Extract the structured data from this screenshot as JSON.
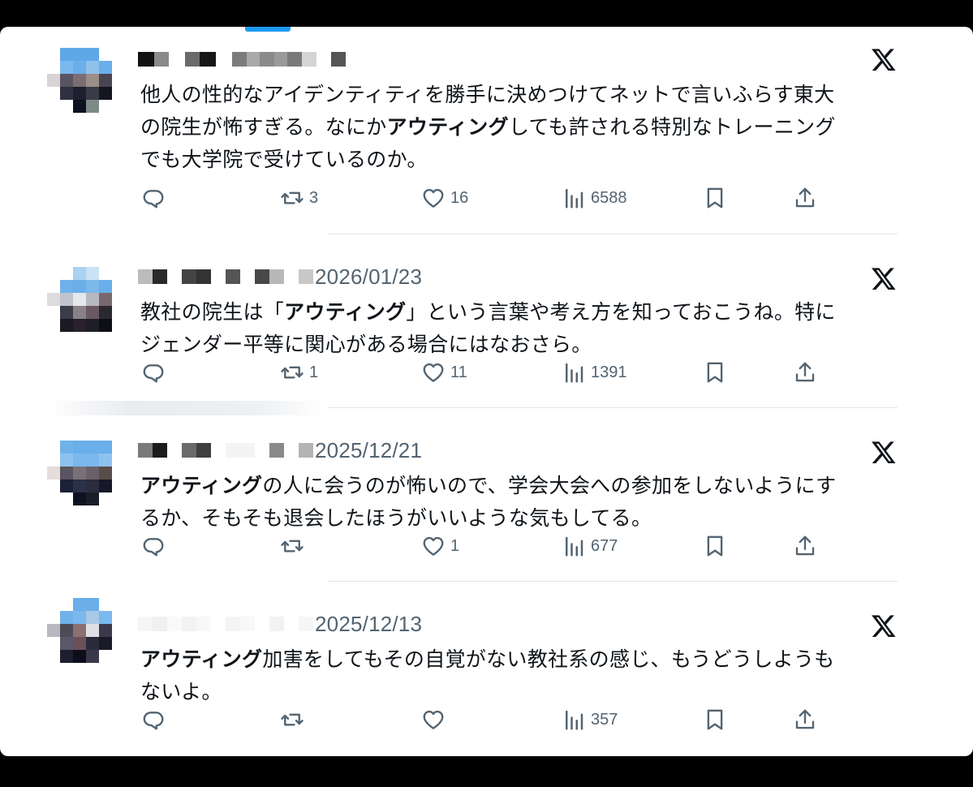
{
  "colors": {
    "accent": "#1d9bf0",
    "text": "#0f1419",
    "muted": "#536471"
  },
  "tweets": [
    {
      "date": "",
      "segments": [
        {
          "t": "他人の性的なアイデンティティを勝手に決めつけてネットで言いふらす東大\nの院生が怖すぎる。なにか",
          "b": false
        },
        {
          "t": "アウティング",
          "b": true
        },
        {
          "t": "しても許される特別なトレーニング\nでも大学院で受けているのか。",
          "b": false
        }
      ],
      "stats": {
        "replies": "",
        "retweets": "3",
        "likes": "16",
        "views": "6588"
      }
    },
    {
      "date": "2026/01/23",
      "segments": [
        {
          "t": "教社の院生は「",
          "b": false
        },
        {
          "t": "アウティング",
          "b": true
        },
        {
          "t": "」という言葉や考え方を知っておこうね。特に\nジェンダー平等に関心がある場合にはなおさら。",
          "b": false
        }
      ],
      "stats": {
        "replies": "",
        "retweets": "1",
        "likes": "11",
        "views": "1391"
      }
    },
    {
      "date": "2025/12/21",
      "segments": [
        {
          "t": "アウティング",
          "b": true
        },
        {
          "t": "の人に会うのが怖いので、学会大会への参加をしないようにす\nるか、そもそも退会したほうがいいような気もしてる。",
          "b": false
        }
      ],
      "stats": {
        "replies": "",
        "retweets": "",
        "likes": "1",
        "views": "677"
      }
    },
    {
      "date": "2025/12/13",
      "segments": [
        {
          "t": "アウティング",
          "b": true
        },
        {
          "t": "加害をしてもその自覚がない教社系の感じ、もうどうしようも\nないよ。",
          "b": false
        }
      ],
      "stats": {
        "replies": "",
        "retweets": "",
        "likes": "",
        "views": "357"
      }
    }
  ],
  "icons": {
    "reply": "reply-icon",
    "retweet": "retweet-icon",
    "like": "heart-icon",
    "views": "views-icon",
    "bookmark": "bookmark-icon",
    "share": "share-icon",
    "logo": "x-logo-icon"
  }
}
